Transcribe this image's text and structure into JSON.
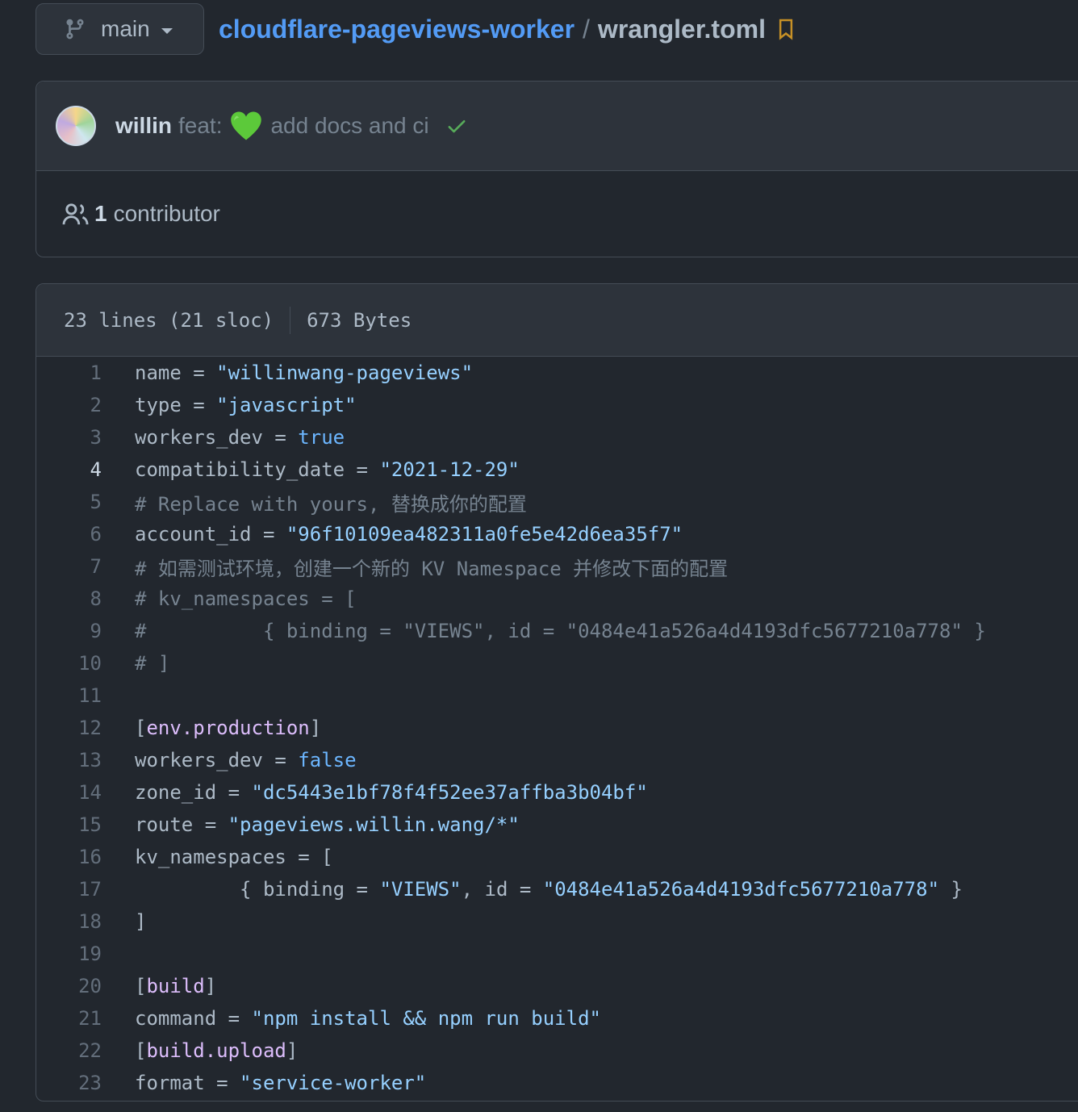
{
  "branch": {
    "name": "main"
  },
  "breadcrumb": {
    "repo": "cloudflare-pageviews-worker",
    "separator": "/",
    "file": "wrangler.toml"
  },
  "commit": {
    "author": "willin",
    "message_prefix": "feat:",
    "message": "add docs and ci",
    "status": "success"
  },
  "contributors": {
    "count": "1",
    "label": "contributor"
  },
  "file_info": {
    "lines": "23 lines (21 sloc)",
    "size": "673 Bytes"
  },
  "code_lines": [
    "name = \"willinwang-pageviews\"",
    "type = \"javascript\"",
    "workers_dev = true",
    "compatibility_date = \"2021-12-29\"",
    "# Replace with yours, 替换成你的配置",
    "account_id = \"96f10109ea482311a0fe5e42d6ea35f7\"",
    "# 如需测试环境，创建一个新的 KV Namespace 并修改下面的配置",
    "# kv_namespaces = [",
    "#          { binding = \"VIEWS\", id = \"0484e41a526a4d4193dfc5677210a778\" }",
    "# ]",
    "",
    "[env.production]",
    "workers_dev = false",
    "zone_id = \"dc5443e1bf78f4f52ee37affba3b04bf\"",
    "route = \"pageviews.willin.wang/*\"",
    "kv_namespaces = [",
    "         { binding = \"VIEWS\", id = \"0484e41a526a4d4193dfc5677210a778\" }",
    "]",
    "",
    "[build]",
    "command = \"npm install && npm run build\"",
    "[build.upload]",
    "format = \"service-worker\""
  ],
  "active_line": 4,
  "colors": {
    "link": "#539bf5",
    "string": "#96d0ff",
    "keyword": "#6cb6ff",
    "comment": "#768390",
    "table": "#dcbdfb",
    "check": "#57ab5a"
  }
}
